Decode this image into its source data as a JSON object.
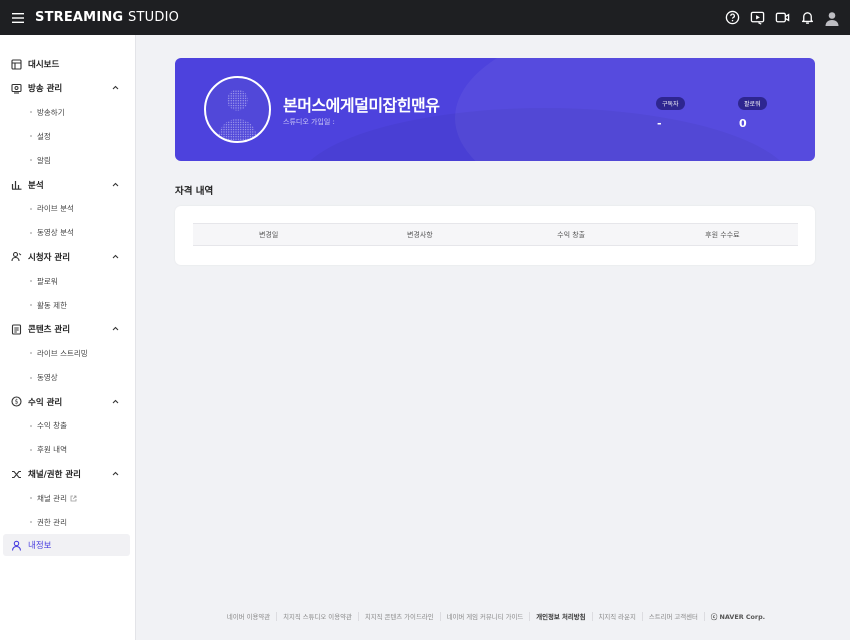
{
  "topbar": {
    "logo_bold": "STREAMING",
    "logo_light": "STUDIO",
    "icons": [
      "help-icon",
      "live-studio-icon",
      "video-icon",
      "bell-icon",
      "user-avatar-icon"
    ]
  },
  "sidebar": {
    "dashboard": "대시보드",
    "broadcast": {
      "label": "방송 관리",
      "items": [
        "방송하기",
        "설정",
        "알림"
      ]
    },
    "analytics": {
      "label": "분석",
      "items": [
        "라이브 분석",
        "동영상 분석"
      ]
    },
    "viewers": {
      "label": "시청자 관리",
      "items": [
        "팔로워",
        "활동 제한"
      ]
    },
    "content": {
      "label": "콘텐츠 관리",
      "items": [
        "라이브 스트리밍",
        "동영상"
      ]
    },
    "revenue": {
      "label": "수익 관리",
      "items": [
        "수익 창출",
        "후원 내역"
      ]
    },
    "channel": {
      "label": "채널/권한 관리",
      "items": [
        "채널 관리",
        "권한 관리"
      ]
    },
    "myinfo": "내정보"
  },
  "profile": {
    "name": "본머스에게덜미잡힌맨유",
    "subtitle": "스튜디오 가입일 :",
    "stats": [
      {
        "label": "구독자",
        "value": "-"
      },
      {
        "label": "팔로워",
        "value": "0"
      }
    ]
  },
  "section": {
    "title": "자격 내역",
    "columns": [
      "변경일",
      "변경사항",
      "수익 창출",
      "후원 수수료"
    ]
  },
  "footer": {
    "links": [
      "네이버 이용약관",
      "치지직 스튜디오 이용약관",
      "치지직 콘텐츠 가이드라인",
      "네이버 게임 커뮤니티 가이드",
      "개인정보 처리방침",
      "치지직 라운지",
      "스트리머 고객센터"
    ],
    "copyright": "ⓒ NAVER Corp."
  },
  "colors": {
    "accent": "#4d42dd",
    "topbar": "#1e1f22"
  }
}
